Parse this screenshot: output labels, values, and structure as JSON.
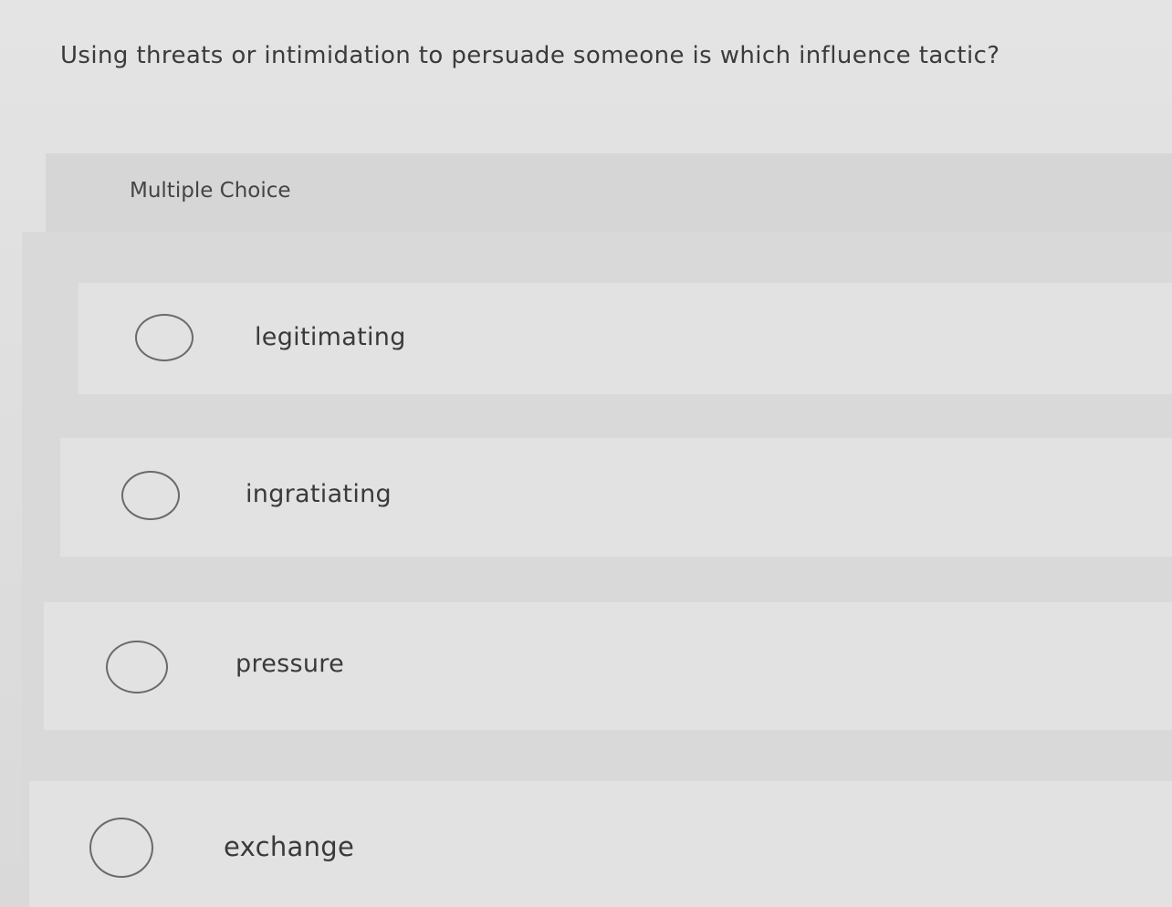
{
  "question": {
    "text": "Using threats or intimidation to persuade someone is which influence tactic?"
  },
  "header": {
    "label": "Multiple Choice"
  },
  "options": [
    {
      "label": "legitimating",
      "selected": false
    },
    {
      "label": "ingratiating",
      "selected": false
    },
    {
      "label": "pressure",
      "selected": false
    },
    {
      "label": "exchange",
      "selected": false
    }
  ],
  "colors": {
    "background": "#dedede",
    "header_band": "#d6d6d6",
    "option_row": "#e2e2e2",
    "text": "#3a3a3a",
    "radio_border": "#6a6a6a"
  }
}
